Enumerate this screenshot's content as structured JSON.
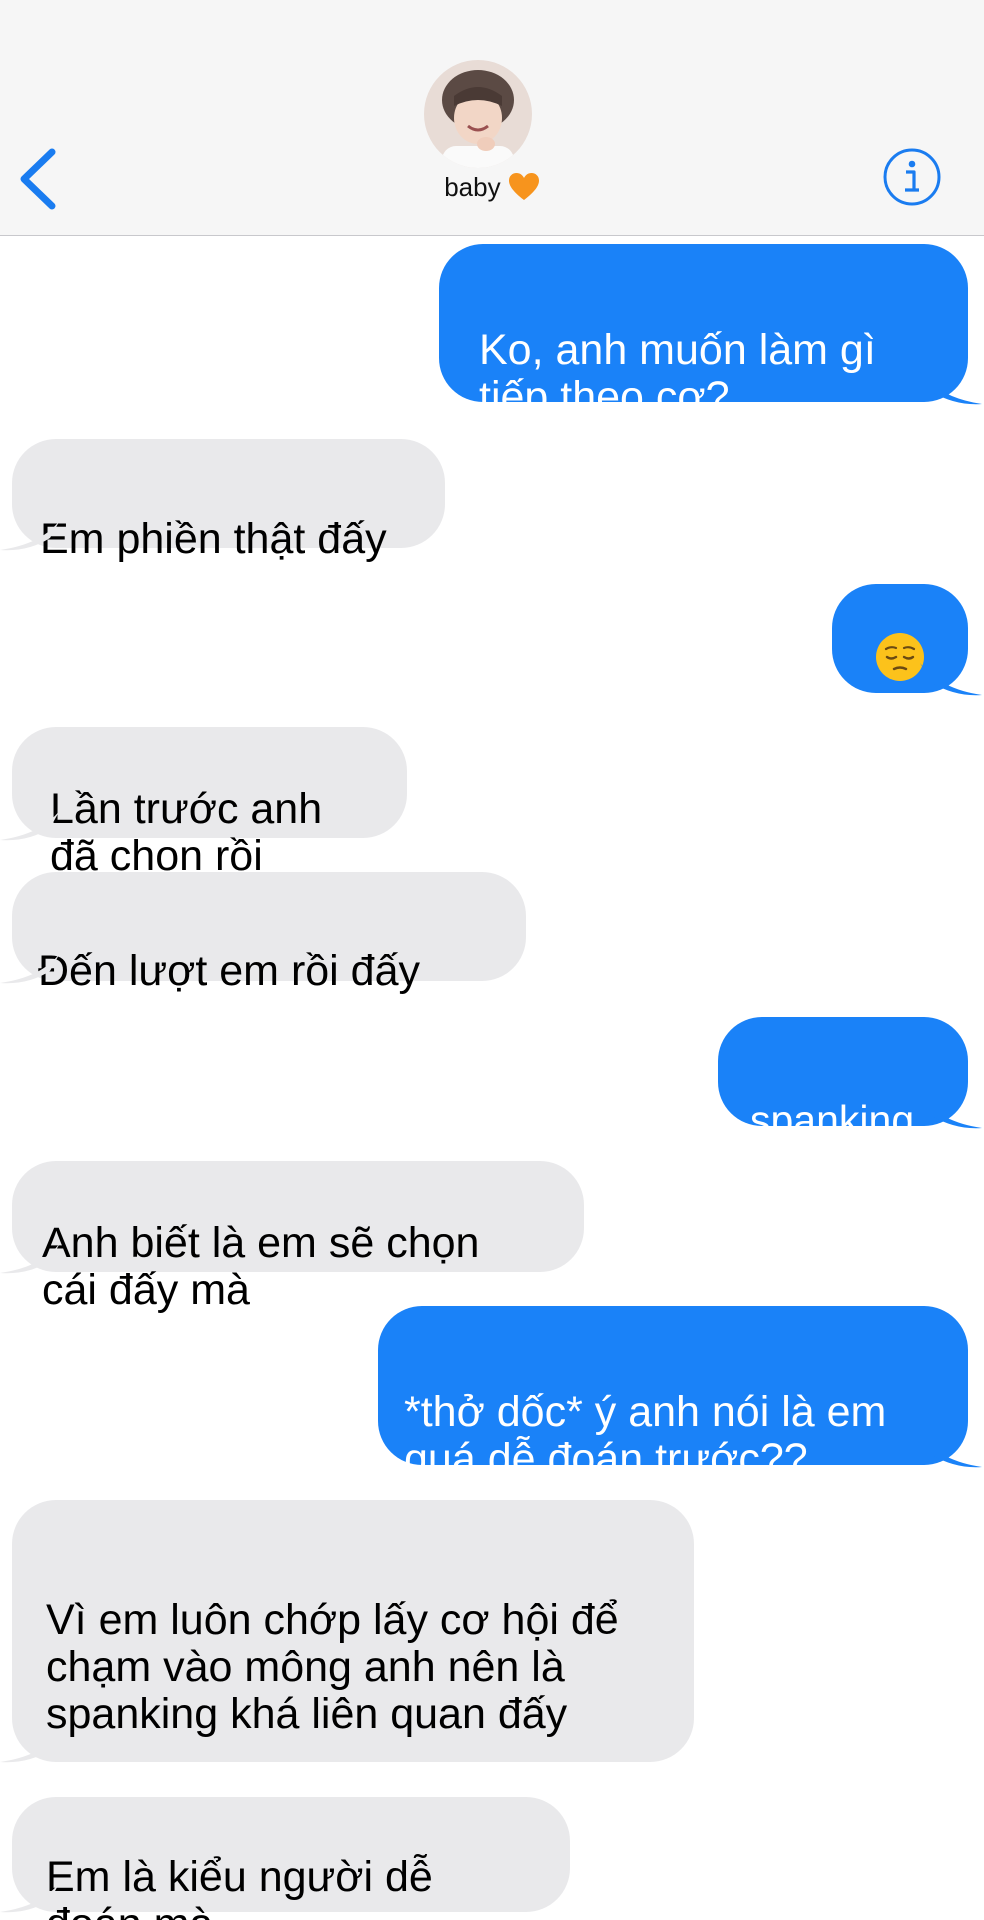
{
  "header": {
    "contact_name": "baby",
    "heart_emoji": "🧡"
  },
  "colors": {
    "sent_bubble": "#1a82f8",
    "received_bubble": "#e9e9eb",
    "header_bg": "#f6f6f6",
    "accent": "#1a7cf0"
  },
  "icons": {
    "back": "chevron-left-icon",
    "info": "info-circle-icon",
    "emoji": "pensive-face-emoji"
  },
  "messages": [
    {
      "direction": "sent",
      "text": "Ko, anh muốn làm gì\ntiếp theo cơ?"
    },
    {
      "direction": "received",
      "text": "Em phiền thật đấy"
    },
    {
      "direction": "sent",
      "text": "😔"
    },
    {
      "direction": "received",
      "text": "Lần trước anh\nđã chọn rồi"
    },
    {
      "direction": "received",
      "text": "Đến lượt em rồi đấy"
    },
    {
      "direction": "sent",
      "text": "spanking"
    },
    {
      "direction": "received",
      "text": "Anh biết là em sẽ chọn\ncái đấy mà"
    },
    {
      "direction": "sent",
      "text": "*thở dốc* ý anh nói là em\nquá dễ đoán trước??"
    },
    {
      "direction": "received",
      "text": "Vì em luôn chớp lấy cơ hội để\nchạm vào mông anh nên là\nspanking khá liên quan đấy"
    },
    {
      "direction": "received",
      "text": "Em là kiểu người dễ\nđoán mà"
    }
  ]
}
